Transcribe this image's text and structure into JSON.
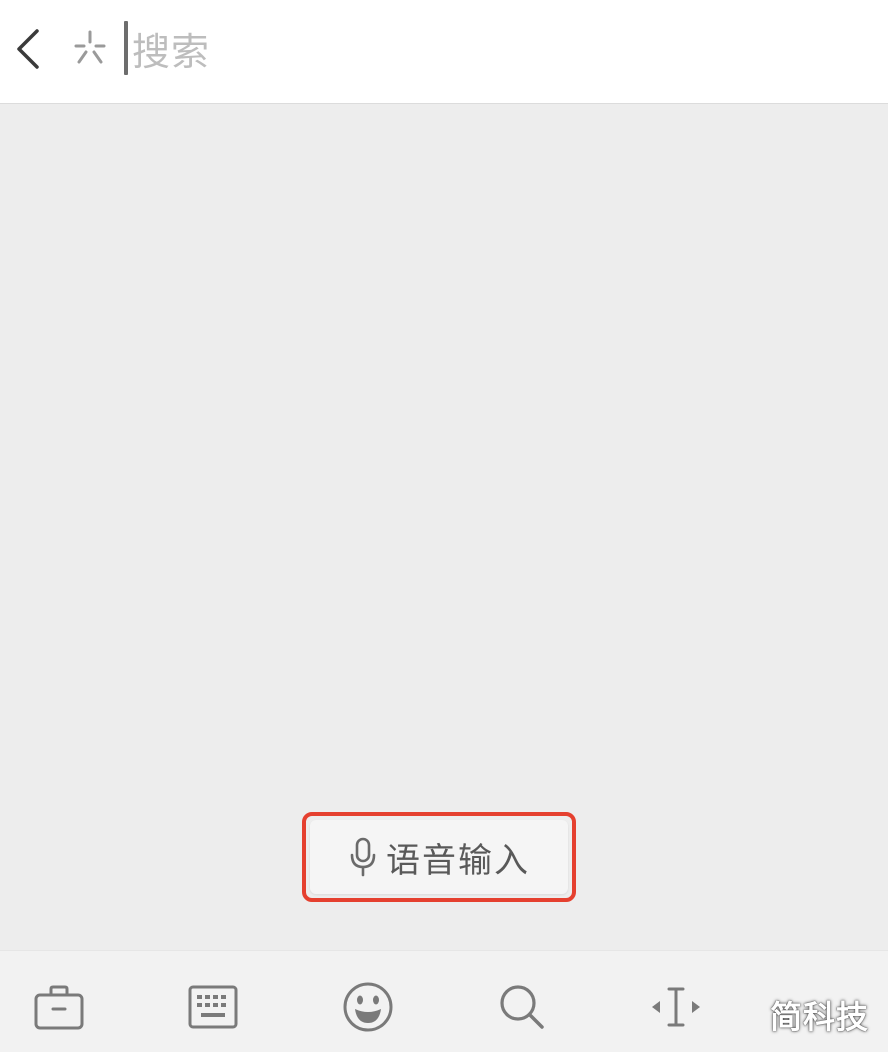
{
  "search": {
    "placeholder": "搜索"
  },
  "voice_input": {
    "label": "语音输入",
    "highlight_color": "#e5402f"
  },
  "icons": {
    "back": "back-chevron-icon",
    "spark": "spark-icon",
    "microphone": "microphone-icon",
    "toolbar": [
      "toolbox-icon",
      "keyboard-icon",
      "emoji-icon",
      "search-icon",
      "cursor-move-icon"
    ]
  },
  "watermark": {
    "text": "简科技"
  }
}
